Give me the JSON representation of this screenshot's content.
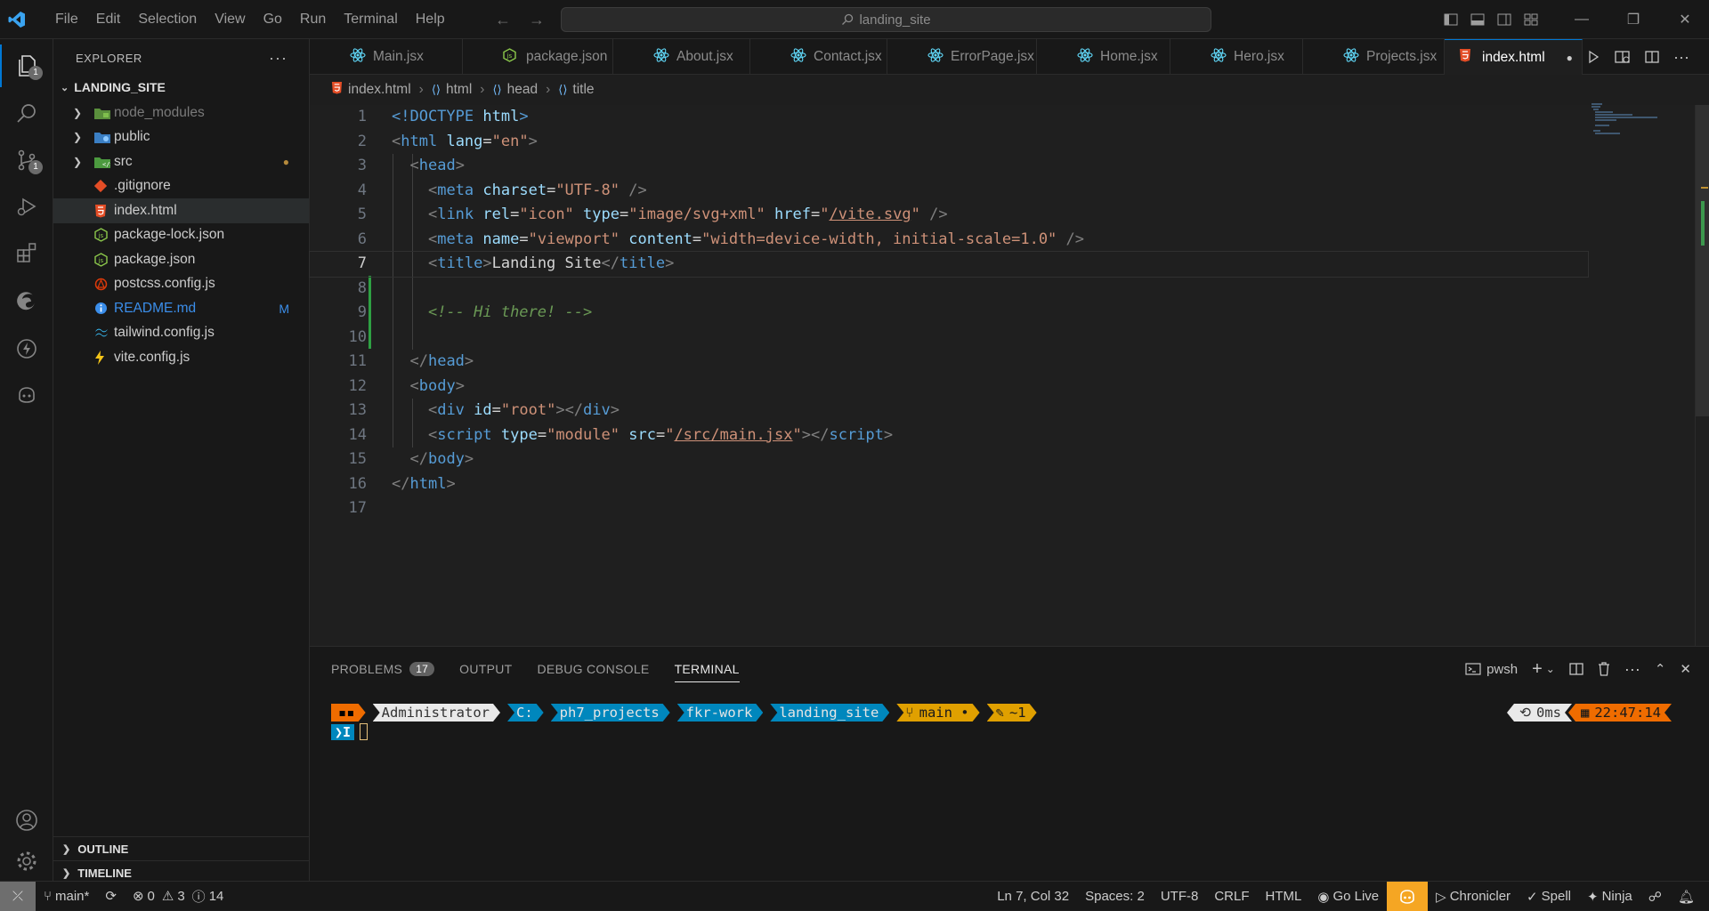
{
  "menu": [
    "File",
    "Edit",
    "Selection",
    "View",
    "Go",
    "Run",
    "Terminal",
    "Help"
  ],
  "search": {
    "label": "landing_site"
  },
  "activity": {
    "explorer_badge": "1",
    "scm_badge": "1"
  },
  "explorer": {
    "title": "EXPLORER",
    "folder": "LANDING_SITE",
    "items": [
      {
        "label": "node_modules"
      },
      {
        "label": "public"
      },
      {
        "label": "src"
      },
      {
        "label": ".gitignore"
      },
      {
        "label": "index.html"
      },
      {
        "label": "package-lock.json"
      },
      {
        "label": "package.json"
      },
      {
        "label": "postcss.config.js"
      },
      {
        "label": "README.md",
        "decoration": "M"
      },
      {
        "label": "tailwind.config.js"
      },
      {
        "label": "vite.config.js"
      }
    ],
    "outline": "OUTLINE",
    "timeline": "TIMELINE"
  },
  "tabs": [
    "Main.jsx",
    "package.json",
    "About.jsx",
    "Contact.jsx",
    "ErrorPage.jsx",
    "Home.jsx",
    "Hero.jsx",
    "Projects.jsx",
    "index.html"
  ],
  "breadcrumb": [
    "index.html",
    "html",
    "head",
    "title"
  ],
  "code": {
    "line_numbers": [
      "1",
      "2",
      "3",
      "4",
      "5",
      "6",
      "7",
      "8",
      "9",
      "10",
      "11",
      "12",
      "13",
      "14",
      "15",
      "16",
      "17"
    ],
    "l1a": "<!DOCTYPE",
    "l1b": " html",
    "l1c": ">",
    "l2_tag": "html",
    "l2_attr": "lang",
    "l2_val": "\"en\"",
    "l3_tag": "head",
    "l4_tag": "meta",
    "l4_attr": "charset",
    "l4_val": "\"UTF-8\"",
    "l5_tag": "link",
    "l5_a1": "rel",
    "l5_v1": "\"icon\"",
    "l5_a2": "type",
    "l5_v2": "\"image/svg+xml\"",
    "l5_a3": "href",
    "l5_v3q": "\"",
    "l5_v3": "/vite.svg",
    "l6_tag": "meta",
    "l6_a1": "name",
    "l6_v1": "\"viewport\"",
    "l6_a2": "content",
    "l6_v2": "\"width=device-width, initial-scale=1.0\"",
    "l7_tag": "title",
    "l7_text": "Landing Site",
    "l9_comment": "<!-- Hi there! -->",
    "l11_tag": "head",
    "l12_tag": "body",
    "l13_tag": "div",
    "l13_attr": "id",
    "l13_val": "\"root\"",
    "l14_tag": "script",
    "l14_a1": "type",
    "l14_v1": "\"module\"",
    "l14_a2": "src",
    "l14_v2": "/src/main.jsx",
    "l15_tag": "body",
    "l16_tag": "html"
  },
  "panel": {
    "tabs": [
      "PROBLEMS",
      "OUTPUT",
      "DEBUG CONSOLE",
      "TERMINAL"
    ],
    "problems_count": "17",
    "shell": "pwsh",
    "prompt": {
      "user": "Administrator",
      "path": [
        "C:",
        "ph7_projects",
        "fkr-work",
        "landing_site"
      ],
      "branch": "main •",
      "changes": "~1",
      "duration": "0ms",
      "time": "22:47:14"
    }
  },
  "status": {
    "branch": "main*",
    "errors": "0",
    "warnings": "3",
    "info": "14",
    "position": "Ln 7, Col 32",
    "spaces": "Spaces: 2",
    "encoding": "UTF-8",
    "eol": "CRLF",
    "language": "HTML",
    "golive": "Go Live",
    "chronicler": "Chronicler",
    "spell": "Spell",
    "ninja": "Ninja"
  },
  "colors": {
    "accent": "#0078d4",
    "git_modified": "#2ea043",
    "copilot": "#f5a623"
  }
}
